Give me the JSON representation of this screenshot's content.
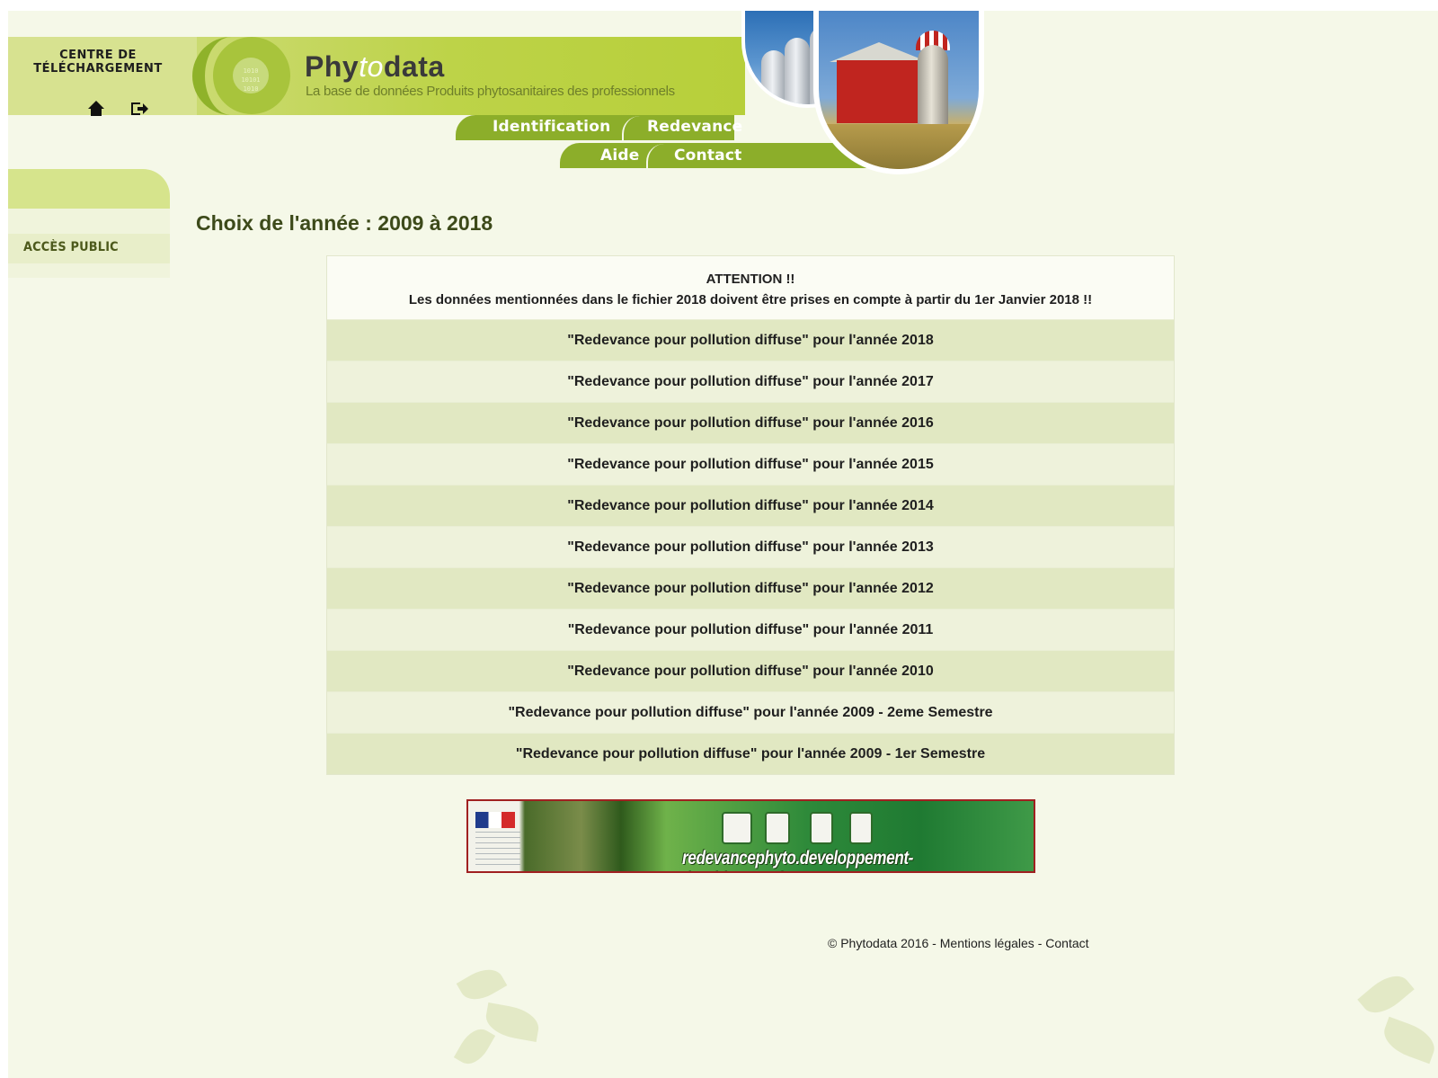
{
  "header": {
    "download_center_title": "CENTRE DE TÉLÉCHARGEMENT",
    "brand_part1": "Phy",
    "brand_part2": "to",
    "brand_part3": "data",
    "tagline": "La base de données Produits phytosanitaires des professionnels",
    "nav": {
      "identification": "Identification",
      "redevance": "Redevance",
      "aide": "Aide",
      "contact": "Contact"
    },
    "logo_bits": "1010 10101 1010"
  },
  "sidebar": {
    "public_access": "ACCÈS PUBLIC"
  },
  "main": {
    "title": "Choix de l'année : 2009 à 2018",
    "notice_line1": "ATTENTION !!",
    "notice_line2": "Les données mentionnées dans le fichier 2018 doivent être prises en compte à partir du 1er Janvier 2018 !!",
    "rows": [
      "\"Redevance pour pollution diffuse\" pour l'année 2018",
      "\"Redevance pour pollution diffuse\" pour l'année 2017",
      "\"Redevance pour pollution diffuse\" pour l'année 2016",
      "\"Redevance pour pollution diffuse\" pour l'année 2015",
      "\"Redevance pour pollution diffuse\" pour l'année 2014",
      "\"Redevance pour pollution diffuse\" pour l'année 2013",
      "\"Redevance pour pollution diffuse\" pour l'année 2012",
      "\"Redevance pour pollution diffuse\" pour l'année 2011",
      "\"Redevance pour pollution diffuse\" pour l'année 2010",
      "\"Redevance pour pollution diffuse\" pour l'année 2009 - 2eme Semestre",
      "\"Redevance pour pollution diffuse\" pour l'année 2009 - 1er Semestre"
    ]
  },
  "banner": {
    "url_text": "redevancephyto.developpement-durable.gouv.fr"
  },
  "footer": {
    "copyright": "© Phytodata 2016",
    "sep1": " - ",
    "legal": "Mentions légales",
    "sep2": " - ",
    "contact": "Contact"
  },
  "colors": {
    "background": "#f5f8e8",
    "brand_green": "#8cae2a",
    "title_text": "#3d4a1a",
    "row_odd": "#e1e8c2",
    "row_even": "#eef2db"
  },
  "icons": {
    "home": "home-icon",
    "logout": "logout-icon"
  }
}
